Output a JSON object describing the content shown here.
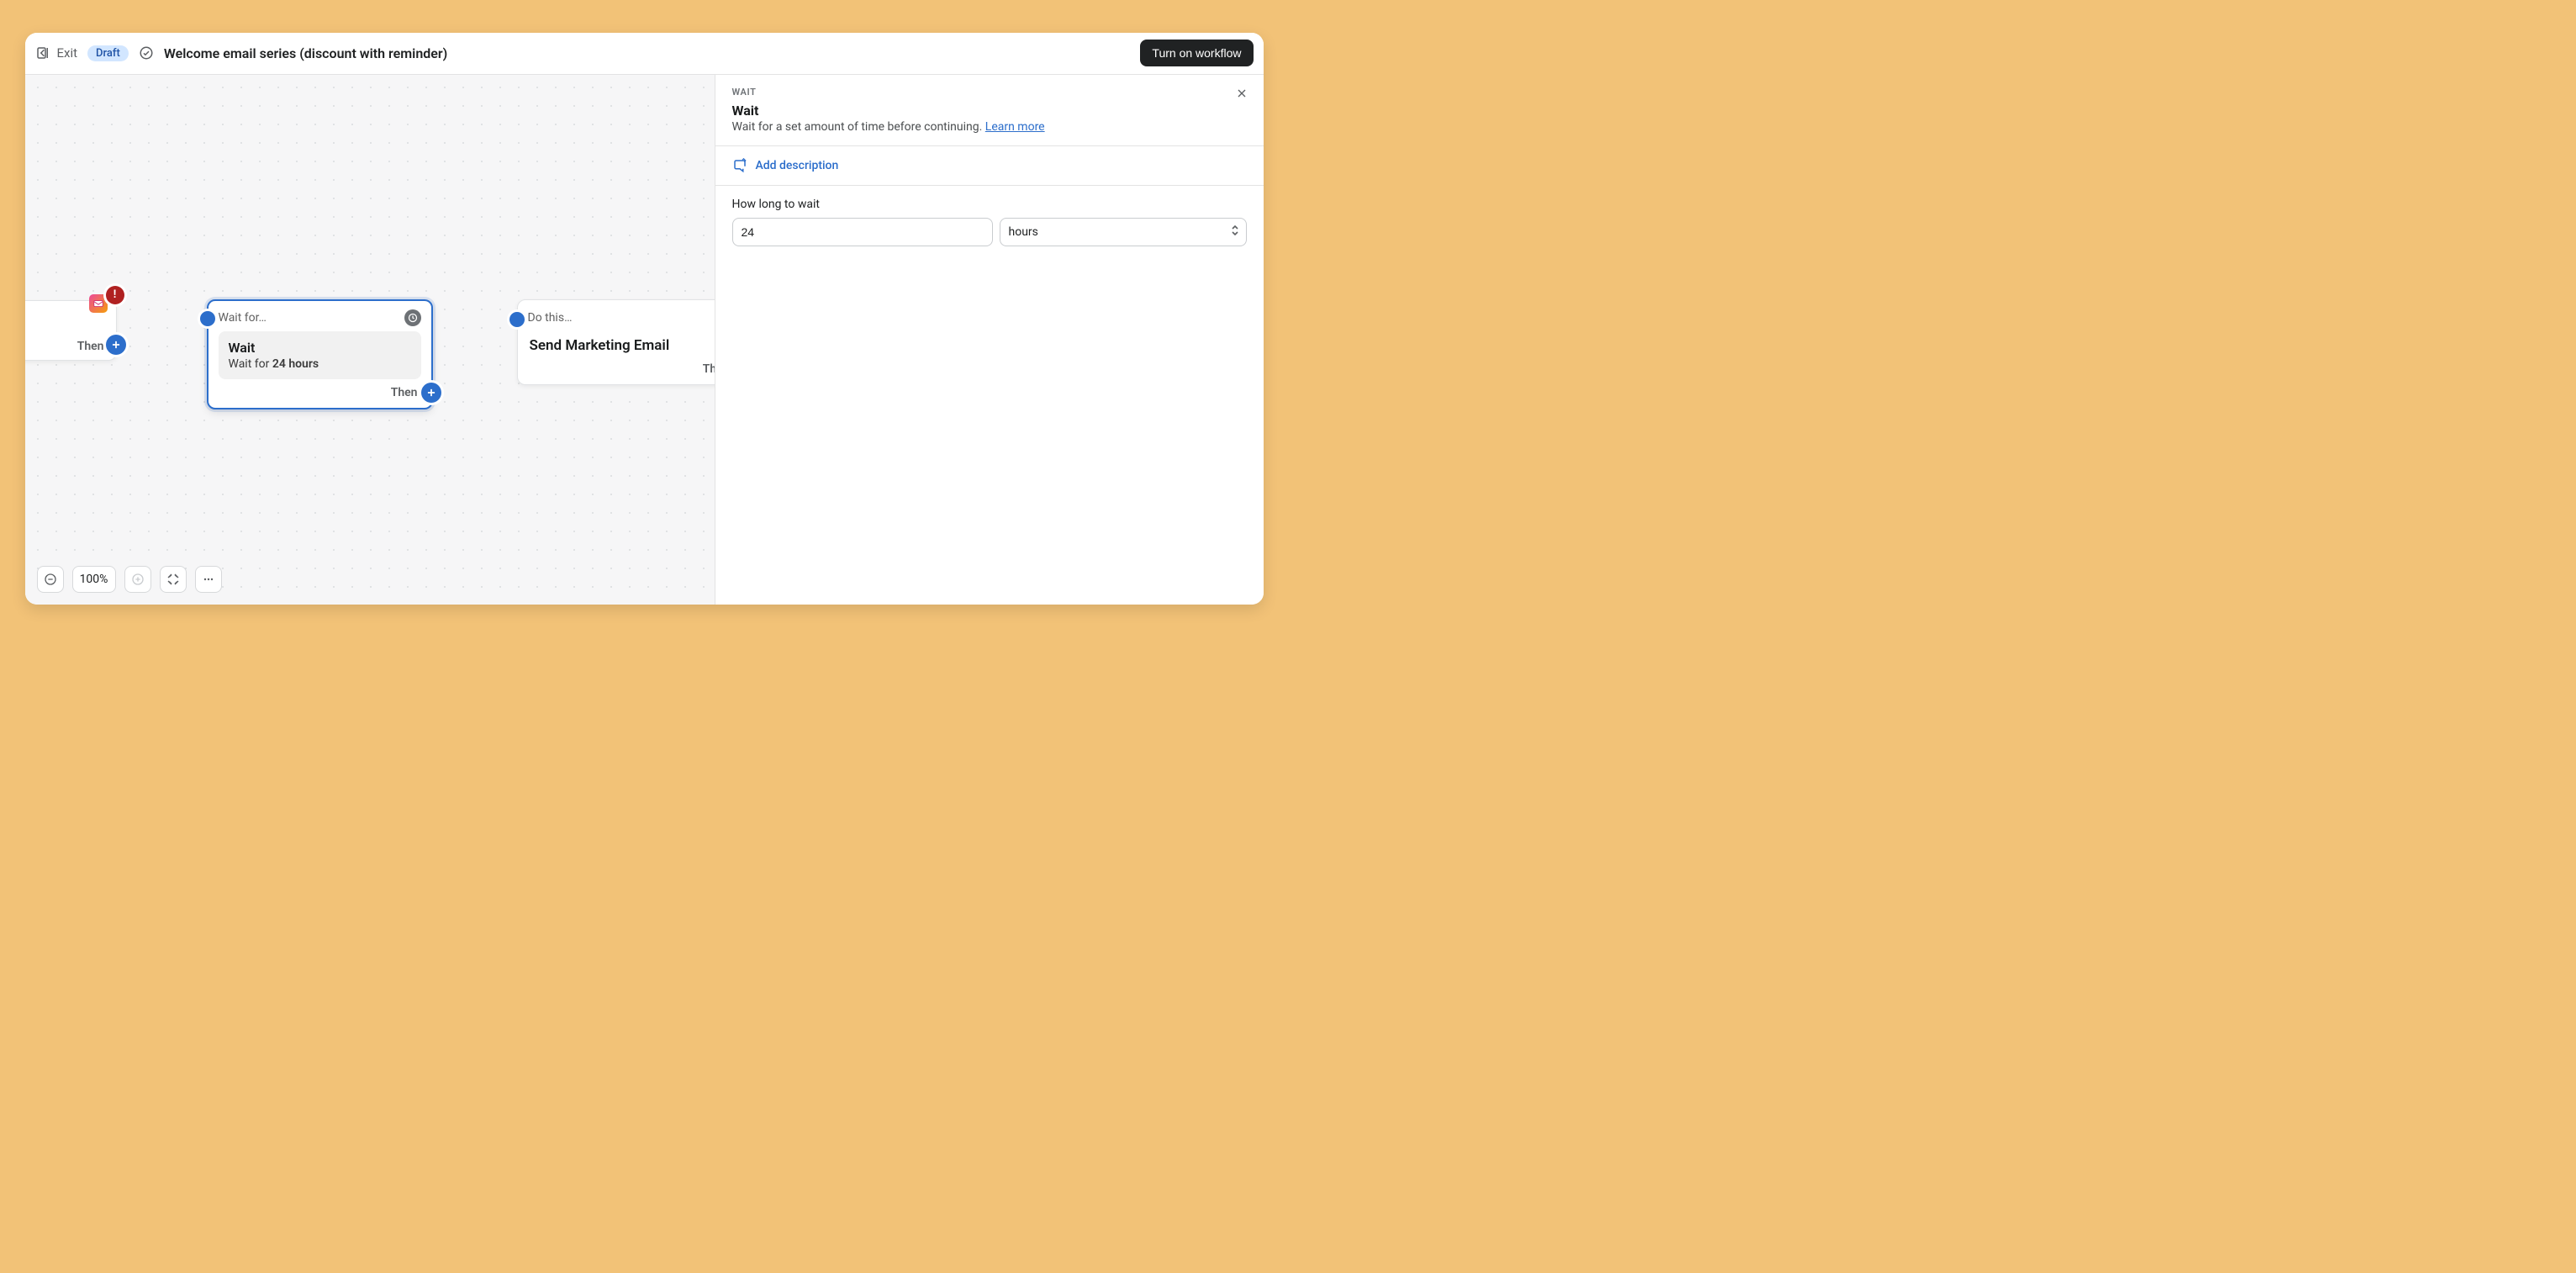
{
  "header": {
    "exit_label": "Exit",
    "status_badge": "Draft",
    "workflow_title": "Welcome email series (discount with reminder)",
    "primary_button": "Turn on workflow"
  },
  "canvas": {
    "zoom_percent": "100%",
    "nodes": {
      "email_truncated": {
        "title_fragment": "mail",
        "then_label": "Then"
      },
      "wait": {
        "header_label": "Wait for…",
        "body_title": "Wait",
        "body_sub_prefix": "Wait for ",
        "body_sub_bold": "24 hours",
        "then_label": "Then"
      },
      "send_email": {
        "header_label": "Do this…",
        "body_title": "Send Marketing Email",
        "then_label": "Then"
      }
    }
  },
  "side_panel": {
    "kicker": "WAIT",
    "title": "Wait",
    "description": "Wait for a set amount of time before continuing. ",
    "learn_more": "Learn more",
    "add_description": "Add description",
    "field_label": "How long to wait",
    "duration_value": "24",
    "unit_value": "hours"
  }
}
